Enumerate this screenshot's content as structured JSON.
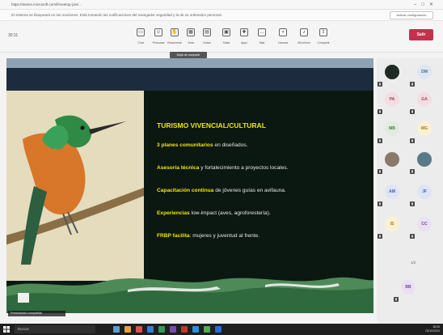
{
  "window": {
    "title": "https://teams.microsoft.com/l/meetup-join/…"
  },
  "notice": {
    "text": "El sistema se bloqueará en las reuniones. Está tomando las notificaciones del navegador seguridad y la de su ordenador personal.",
    "button": "Activar configuración"
  },
  "toolbar": {
    "timer": "30:11",
    "tools": [
      {
        "label": "Chat",
        "icon": "chat-icon",
        "glyph": "▭"
      },
      {
        "label": "Personas",
        "icon": "people-icon",
        "glyph": "☺"
      },
      {
        "label": "Reaccionar",
        "icon": "hand-icon",
        "glyph": "✋"
      },
      {
        "label": "Vista",
        "icon": "grid-icon",
        "glyph": "▦"
      },
      {
        "label": "Notas",
        "icon": "notes-icon",
        "glyph": "▤"
      },
      {
        "label": "Salas",
        "icon": "rooms-icon",
        "glyph": "▣"
      },
      {
        "label": "Apps",
        "icon": "apps-icon",
        "glyph": "✚"
      },
      {
        "label": "Más",
        "icon": "more-icon",
        "glyph": "…"
      },
      {
        "label": "Cámara",
        "icon": "camera-icon",
        "glyph": "▪"
      },
      {
        "label": "Micrófono",
        "icon": "mic-icon",
        "glyph": "♪"
      },
      {
        "label": "Compartir",
        "icon": "share-icon",
        "glyph": "⇪"
      }
    ],
    "leave": "Salir",
    "tooltip": "Dejar de compartir"
  },
  "slide": {
    "heading": "TURISMO VIVENCIAL/CULTURAL",
    "bullets": [
      {
        "bold": "3 planes comunitarios",
        "rest": " en diseñados."
      },
      {
        "bold": "Asesoría técnica",
        "rest": " y fortalecimiento a proyectos locales."
      },
      {
        "bold": "Capacitación continua",
        "rest": " de jóvenes guías en avifauna."
      },
      {
        "bold": "Experiencias",
        "rest": " low-impact (aves, agroforestería)."
      },
      {
        "bold": "FRBP facilita",
        "rest": ": mujeres y juventud al frente."
      }
    ],
    "caption": "Presentación compartida"
  },
  "participants": {
    "tiles": [
      {
        "initials": "",
        "color": "#1e2b22",
        "text": "#ffffff"
      },
      {
        "initials": "DM",
        "color": "#dde7f2",
        "text": "#4a6a8c"
      },
      {
        "initials": "PA",
        "color": "#f3dde3",
        "text": "#a04a62"
      },
      {
        "initials": "GA",
        "color": "#f3dde3",
        "text": "#a04a62"
      },
      {
        "initials": "MB",
        "color": "#e0ecde",
        "text": "#4a7a46"
      },
      {
        "initials": "MG",
        "color": "#fbf0d2",
        "text": "#9a7a22"
      },
      {
        "initials": "",
        "color": "#8a7a6a",
        "text": "#ffffff"
      },
      {
        "initials": "",
        "color": "#5a7a8a",
        "text": "#ffffff"
      },
      {
        "initials": "AM",
        "color": "#dde4f5",
        "text": "#4a5a9c"
      },
      {
        "initials": "JF",
        "color": "#dde4f5",
        "text": "#4a5a9c"
      },
      {
        "initials": "IS",
        "color": "#fbf0d2",
        "text": "#9a7a22"
      },
      {
        "initials": "CC",
        "color": "#e9e1f3",
        "text": "#6a4a8c"
      },
      {
        "initials": "BB",
        "color": "#e9e1f3",
        "text": "#6a4a8c"
      }
    ],
    "page": "1/2"
  },
  "taskbar": {
    "search": "Buscar",
    "time": "18:05",
    "date": "03/10/2024"
  }
}
